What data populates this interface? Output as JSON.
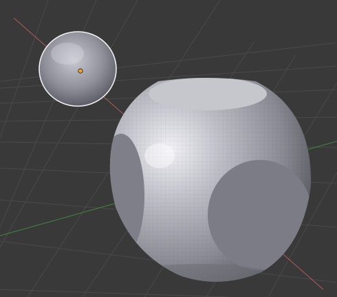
{
  "viewport": {
    "background": "#393939",
    "grid_color": "#4a4a4a",
    "x_axis_color": "#b35c5c",
    "y_axis_color": "#3f8a3f",
    "selection_outline_color": "#f2f2f2",
    "origin_color": "#f3a12b"
  },
  "objects": [
    {
      "name": "small-sphere",
      "selected": true,
      "surface": "smooth"
    },
    {
      "name": "rounded-cube",
      "selected": false,
      "surface": "faceted",
      "flat_faces": 3
    }
  ]
}
